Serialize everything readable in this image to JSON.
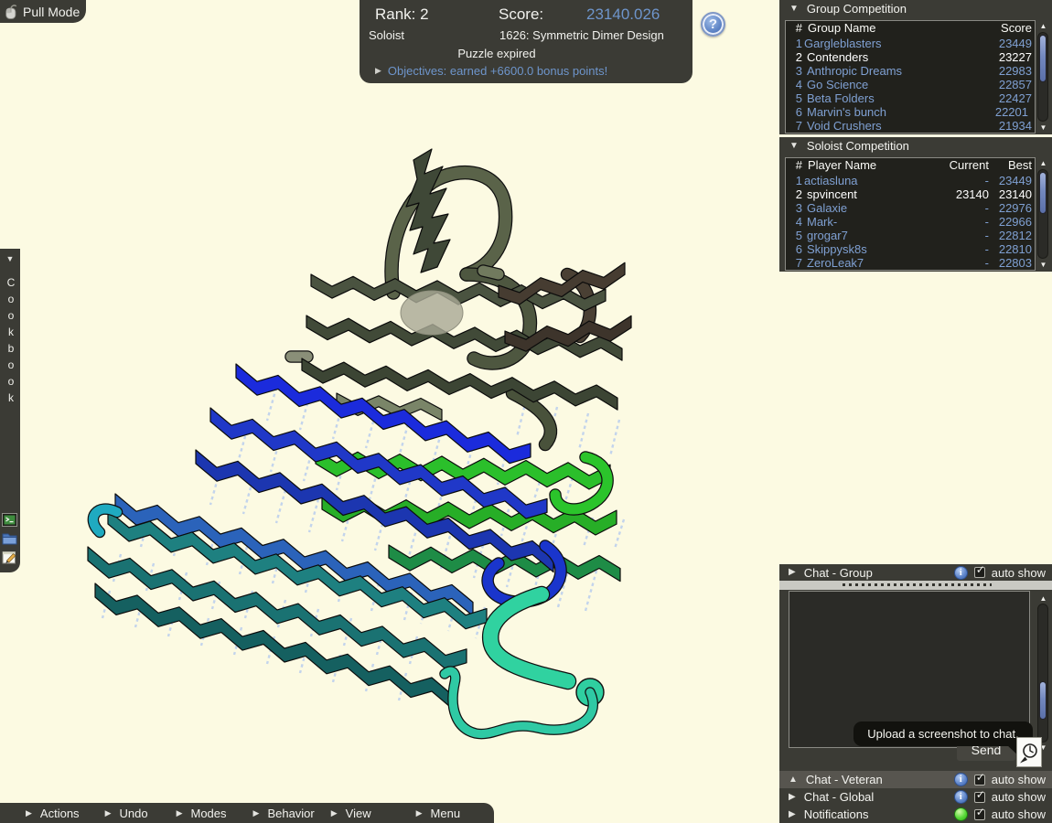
{
  "colors": {
    "background": "#FCFAE2",
    "panel": "#3B3B35",
    "link_blue": "#7FA0D2",
    "score_blue": "#6E95CB",
    "highlight": "#FFFFFF"
  },
  "icons": {
    "collapse": "▼",
    "expand": "▶",
    "up": "▲",
    "scroll_up": "▲",
    "scroll_down": "▼",
    "check": "✓",
    "help": "?",
    "info": "i"
  },
  "pull_mode": {
    "label": "Pull Mode"
  },
  "score_panel": {
    "rank_label": "Rank: 2",
    "score_label": "Score:",
    "score_value": "23140.026",
    "category": "Soloist",
    "puzzle_name": "1626: Symmetric Dimer Design",
    "status": "Puzzle expired",
    "objectives_label": "Objectives: earned +6600.0 bonus points!"
  },
  "group_competition": {
    "title": "Group Competition",
    "columns": {
      "rank": "#",
      "name": "Group Name",
      "score": "Score"
    },
    "rows": [
      {
        "rank": "1",
        "name": "Gargleblasters",
        "score": "23449"
      },
      {
        "rank": "2",
        "name": "Contenders",
        "score": "23227"
      },
      {
        "rank": "3",
        "name": "Anthropic Dreams",
        "score": "22983"
      },
      {
        "rank": "4",
        "name": "Go Science",
        "score": "22857"
      },
      {
        "rank": "5",
        "name": "Beta Folders",
        "score": "22427"
      },
      {
        "rank": "6",
        "name": "Marvin's bunch",
        "score": "22201"
      },
      {
        "rank": "7",
        "name": "Void Crushers",
        "score": "21934"
      }
    ]
  },
  "soloist_competition": {
    "title": "Soloist Competition",
    "columns": {
      "rank": "#",
      "name": "Player Name",
      "current": "Current",
      "best": "Best"
    },
    "rows": [
      {
        "rank": "1",
        "name": "actiasluna",
        "current": "-",
        "best": "23449"
      },
      {
        "rank": "2",
        "name": "spvincent",
        "current": "23140",
        "best": "23140"
      },
      {
        "rank": "3",
        "name": "Galaxie",
        "current": "-",
        "best": "22976"
      },
      {
        "rank": "4",
        "name": "Mark-",
        "current": "-",
        "best": "22966"
      },
      {
        "rank": "5",
        "name": "grogar7",
        "current": "-",
        "best": "22812"
      },
      {
        "rank": "6",
        "name": "Skippysk8s",
        "current": "-",
        "best": "22810"
      },
      {
        "rank": "7",
        "name": "ZeroLeak7",
        "current": "-",
        "best": "22803"
      }
    ]
  },
  "cookbook": {
    "label": "Cookbook"
  },
  "chat_group": {
    "title": "Chat - Group",
    "auto_show": "auto show",
    "send_label": "Send"
  },
  "tooltip": {
    "text": "Upload a screenshot to chat."
  },
  "chat_rows": [
    {
      "title": "Chat - Veteran",
      "auto_show": "auto show"
    },
    {
      "title": "Chat - Global",
      "auto_show": "auto show"
    },
    {
      "title": "Notifications",
      "auto_show": "auto show"
    }
  ],
  "bottom_menu": [
    {
      "label": "Actions"
    },
    {
      "label": "Undo"
    },
    {
      "label": "Modes"
    },
    {
      "label": "Behavior"
    },
    {
      "label": "View"
    },
    {
      "label": "Menu"
    }
  ]
}
